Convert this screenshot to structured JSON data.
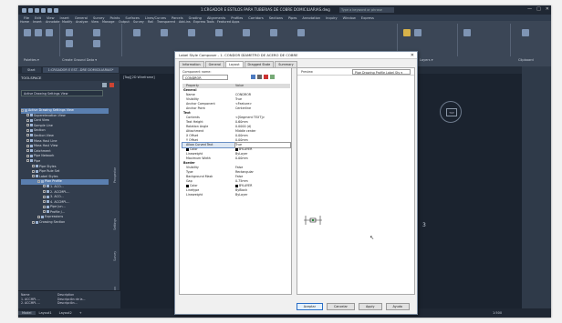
{
  "window": {
    "title": "1:CRGADOR E ESTILOS PARA TUBERIAS DE COBRE DOMICILIARIAS.dwg",
    "search_placeholder": "Type a keyword or phrase",
    "user": "alexx746",
    "controls": [
      "—",
      "□",
      "✕"
    ]
  },
  "menu": [
    "File",
    "Edit",
    "View",
    "Insert",
    "General",
    "Survey",
    "Points",
    "Surfaces",
    "Lines/Curves",
    "Parcels",
    "Grading",
    "Alignments",
    "Profiles",
    "Corridors",
    "Sections",
    "Pipes",
    "Annotation",
    "Inquiry",
    "Window",
    "Express"
  ],
  "ribbon_tabs": [
    "Home",
    "Insert",
    "Annotate",
    "Modify",
    "Analyze",
    "View",
    "Manage",
    "Output",
    "Survey",
    "Rail",
    "Transparent",
    "Add-ins",
    "Express Tools",
    "Featured Apps"
  ],
  "ribbon": {
    "panels": [
      "Palettes ▾",
      "Create Ground Data ▾",
      "Layers ▾",
      "Clipboard"
    ]
  },
  "doc_tabs": [
    "Start",
    "1:CRGADOR E EST...DRE DOMICILIARIAS*",
    "[Top][2D Wireframe]"
  ],
  "toolspace": {
    "title": "TOOLSPACE",
    "active_view": "Active Drawing Settings View",
    "tree": [
      {
        "label": "Active Drawing Settings View",
        "selected": true,
        "indent": 0
      },
      {
        "label": "Superelevation View",
        "indent": 1
      },
      {
        "label": "Cant View",
        "indent": 1
      },
      {
        "label": "Sample Line",
        "indent": 1
      },
      {
        "label": "Section",
        "indent": 1
      },
      {
        "label": "Section View",
        "indent": 1
      },
      {
        "label": "Mass Haul Line",
        "indent": 1
      },
      {
        "label": "Mass Haul View",
        "indent": 1
      },
      {
        "label": "Catchment",
        "indent": 1
      },
      {
        "label": "Pipe Network",
        "indent": 1
      },
      {
        "label": "Pipe",
        "indent": 1
      },
      {
        "label": "Pipe Styles",
        "indent": 2
      },
      {
        "label": "Pipe Rule Set",
        "indent": 2
      },
      {
        "label": "Label Styles",
        "indent": 2
      },
      {
        "label": "Plan Profile",
        "indent": 3,
        "selected": true
      },
      {
        "label": "1. ACO...",
        "indent": 4
      },
      {
        "label": "2. ACCMPL...",
        "indent": 4
      },
      {
        "label": "3. ACO...",
        "indent": 4
      },
      {
        "label": "4. ACCMPL...",
        "indent": 4
      },
      {
        "label": "Pipe Jun...",
        "indent": 4
      },
      {
        "label": "Profile J...",
        "indent": 4
      },
      {
        "label": "Expressions",
        "indent": 3
      },
      {
        "label": "Crossing Section",
        "indent": 2
      }
    ],
    "vertical_tabs": [
      "Prospector",
      "Settings",
      "Survey",
      "Toolbox"
    ],
    "footer": {
      "headers": [
        "Name",
        "Description"
      ],
      "rows": [
        [
          "1. ACCMPL ...",
          "Descripción de la..."
        ],
        [
          "2. ACCMPL ...",
          "Descripción..."
        ]
      ]
    },
    "side_label": "Properties"
  },
  "dialog": {
    "title": "Label Style Composer - 1. CONDOR DÍAMETRO DE ACERO DE COBRE",
    "tabs": [
      "Information",
      "General",
      "Layout",
      "Dragged State",
      "Summary"
    ],
    "active_tab": "Layout",
    "component_label": "Component name:",
    "component_value": "CONDROR",
    "grid_header": [
      "Property",
      "Value"
    ],
    "rows": [
      {
        "group": "General"
      },
      {
        "k": "Name",
        "v": "CONDROR"
      },
      {
        "k": "Visibility",
        "v": "True"
      },
      {
        "k": "Anchor Component",
        "v": "<Feature>"
      },
      {
        "k": "Anchor Point",
        "v": "Centerline"
      },
      {
        "group": "Text"
      },
      {
        "k": "Contents",
        "v": "<[Segment TEXT]>"
      },
      {
        "k": "Text Height",
        "v": "0.60mm"
      },
      {
        "k": "Rotation Angle",
        "v": "0.0000 (d)"
      },
      {
        "k": "Attachment",
        "v": "Middle center"
      },
      {
        "k": "X Offset",
        "v": "0.00mm"
      },
      {
        "k": "Y Offset",
        "v": "0.00mm"
      },
      {
        "k": "Allow Curved Text",
        "v": "True",
        "hl": true
      },
      {
        "k": "Color",
        "v": "BYLAYER",
        "swatch": true
      },
      {
        "k": "Lineweight",
        "v": "ByLayer"
      },
      {
        "k": "Maximum Width",
        "v": "0.00mm"
      },
      {
        "group": "Border"
      },
      {
        "k": "Visibility",
        "v": "False"
      },
      {
        "k": "Type",
        "v": "Rectangular"
      },
      {
        "k": "Background Mask",
        "v": "False"
      },
      {
        "k": "Gap",
        "v": "0.75mm"
      },
      {
        "k": "Color",
        "v": "BYLAYER",
        "swatch": true
      },
      {
        "k": "Linetype",
        "v": "ByBlock"
      },
      {
        "k": "Lineweight",
        "v": "ByLayer"
      }
    ],
    "preview_label": "Preview",
    "preview_select": "Pipe Drawing Profile Label Sty ▾",
    "buttons": [
      "Aceptar",
      "Cancelar",
      "Apply",
      "Ayuda"
    ]
  },
  "status": {
    "tabs": [
      "Model",
      "Layout1",
      "Layout2",
      "+"
    ],
    "right_text": "MODEL",
    "scale": "1:500"
  },
  "canvas": {
    "dim_text": "3"
  }
}
